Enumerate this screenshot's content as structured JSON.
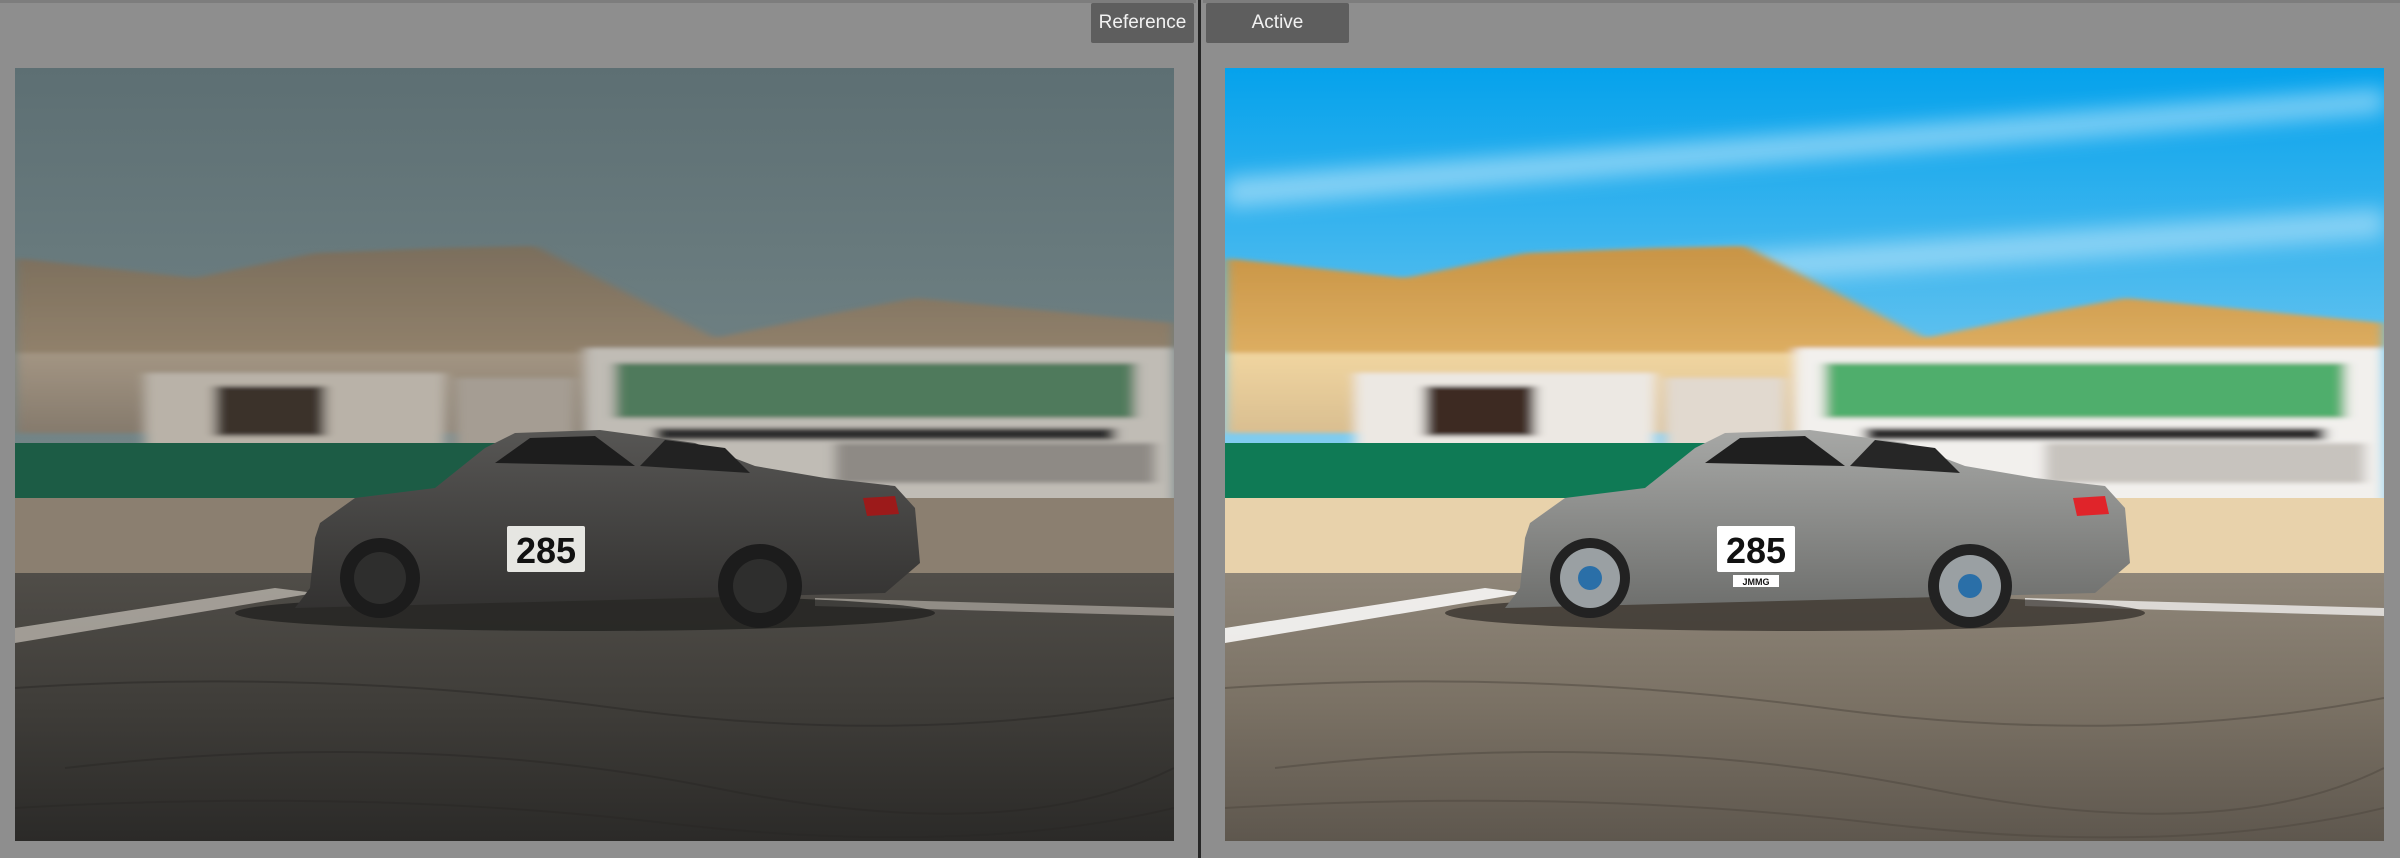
{
  "compare_view": {
    "reference_tab": {
      "label": "Reference"
    },
    "active_tab": {
      "label": "Active"
    },
    "reference_photo": {
      "race_number": "285",
      "grade": "muted"
    },
    "active_photo": {
      "race_number": "285",
      "sticker": "JMMG",
      "grade": "vivid"
    }
  },
  "colors": {
    "background": "#8e8e8e",
    "tab_background": "#5e5e5e",
    "divider": "#262626",
    "reference_sky": "#6d7f82",
    "active_sky": "#0ca6ee",
    "active_barrier": "#0f7a55",
    "reference_barrier": "#1c5c45"
  }
}
